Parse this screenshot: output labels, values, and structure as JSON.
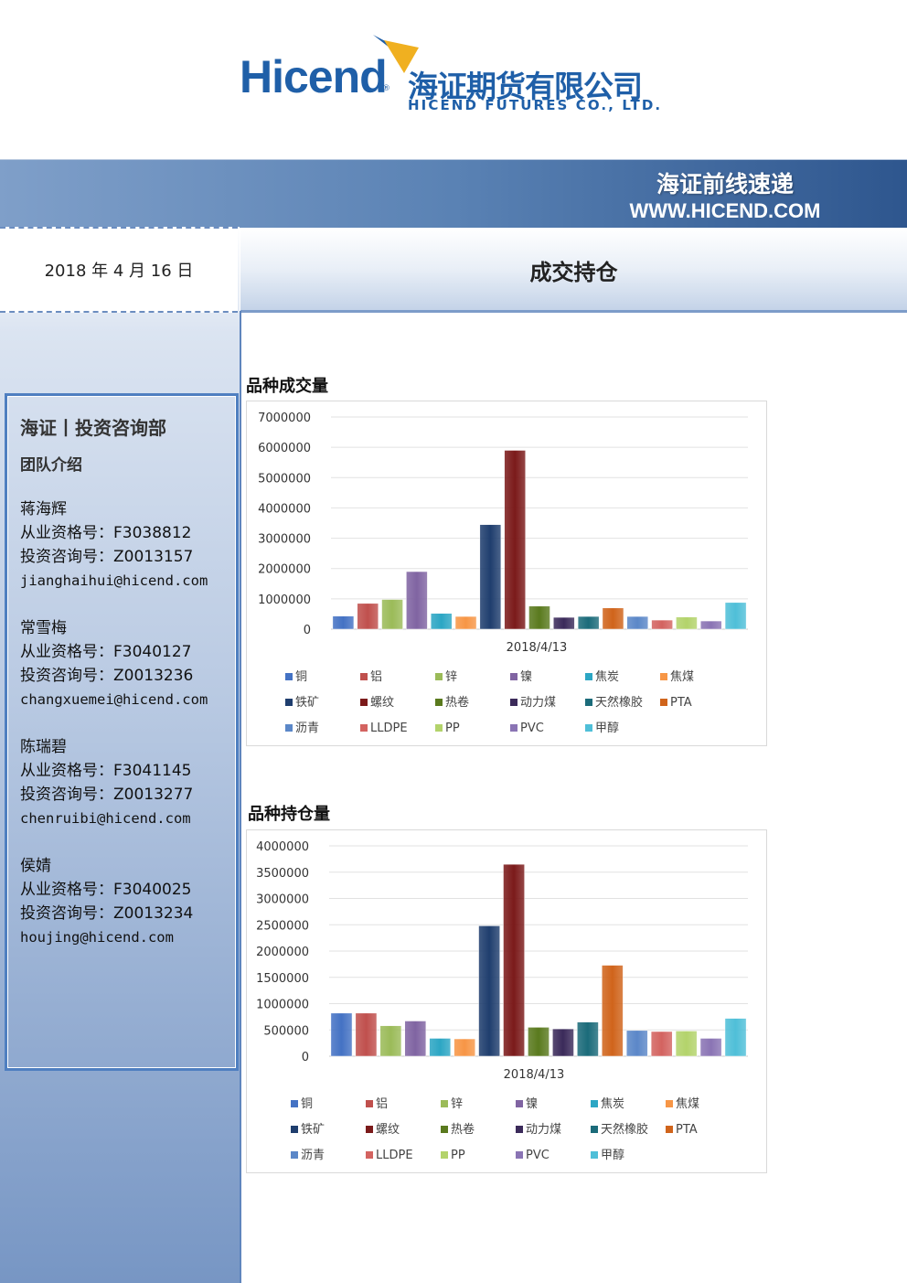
{
  "header": {
    "brand_en": "Hicend",
    "brand_reg": "®",
    "brand_cn": "海证期货有限公司",
    "brand_sub": "HICEND FUTURES CO., LTD.",
    "banner_cn": "海证前线速递",
    "banner_url": "WWW.HICEND.COM"
  },
  "date": "2018 年 4 月 16 日",
  "page_title": "成交持仓",
  "team": {
    "title": "海证丨投资咨询部",
    "subtitle": "团队介绍",
    "members": [
      {
        "name": "蒋海辉",
        "license": "从业资格号：F3038812",
        "advisor": "投资咨询号：Z0013157",
        "email": "jianghaihui@hicend.com"
      },
      {
        "name": "常雪梅",
        "license": "从业资格号：F3040127",
        "advisor": "投资咨询号：Z0013236",
        "email": "changxuemei@hicend.com"
      },
      {
        "name": "陈瑞碧",
        "license": "从业资格号：F3041145",
        "advisor": "投资咨询号：Z0013277",
        "email": "chenruibi@hicend.com"
      },
      {
        "name": "侯婧",
        "license": "从业资格号：F3040025",
        "advisor": "投资咨询号：Z0013234",
        "email": "houjing@hicend.com"
      }
    ]
  },
  "colors": {
    "brand_blue": "#1f5fa8",
    "banner_dark": "#2e568e",
    "frame_border": "#4f7fc0"
  },
  "chart_data": [
    {
      "type": "bar",
      "title": "品种成交量",
      "categories": [
        "2018/4/13"
      ],
      "ylim": [
        0,
        7000000
      ],
      "yticks": [
        0,
        1000000,
        2000000,
        3000000,
        4000000,
        5000000,
        6000000,
        7000000
      ],
      "grid": true,
      "legend_position": "bottom",
      "series": [
        {
          "name": "铜",
          "color": "#4472c4",
          "values": [
            430000
          ]
        },
        {
          "name": "铝",
          "color": "#c0504d",
          "values": [
            850000
          ]
        },
        {
          "name": "锌",
          "color": "#9bbb59",
          "values": [
            980000
          ]
        },
        {
          "name": "镍",
          "color": "#8064a2",
          "values": [
            1900000
          ]
        },
        {
          "name": "焦炭",
          "color": "#2ca6c4",
          "values": [
            520000
          ]
        },
        {
          "name": "焦煤",
          "color": "#f79646",
          "values": [
            420000
          ]
        },
        {
          "name": "铁矿",
          "color": "#1f3e6e",
          "values": [
            3450000
          ]
        },
        {
          "name": "螺纹",
          "color": "#7b1a1a",
          "values": [
            5900000
          ]
        },
        {
          "name": "热卷",
          "color": "#5a7a1e",
          "values": [
            760000
          ]
        },
        {
          "name": "动力煤",
          "color": "#3b2a5a",
          "values": [
            390000
          ]
        },
        {
          "name": "天然橡胶",
          "color": "#1b6b7a",
          "values": [
            420000
          ]
        },
        {
          "name": "PTA",
          "color": "#d0641b",
          "values": [
            700000
          ]
        },
        {
          "name": "沥青",
          "color": "#5b87c8",
          "values": [
            420000
          ]
        },
        {
          "name": "LLDPE",
          "color": "#d36360",
          "values": [
            300000
          ]
        },
        {
          "name": "PP",
          "color": "#b3d36b",
          "values": [
            400000
          ]
        },
        {
          "name": "PVC",
          "color": "#8a74b4",
          "values": [
            270000
          ]
        },
        {
          "name": "甲醇",
          "color": "#4fbfd8",
          "values": [
            880000
          ]
        }
      ]
    },
    {
      "type": "bar",
      "title": "品种持仓量",
      "categories": [
        "2018/4/13"
      ],
      "ylim": [
        0,
        4000000
      ],
      "yticks": [
        0,
        500000,
        1000000,
        1500000,
        2000000,
        2500000,
        3000000,
        3500000,
        4000000
      ],
      "grid": true,
      "legend_position": "bottom",
      "series": [
        {
          "name": "铜",
          "color": "#4472c4",
          "values": [
            820000
          ]
        },
        {
          "name": "铝",
          "color": "#c0504d",
          "values": [
            820000
          ]
        },
        {
          "name": "锌",
          "color": "#9bbb59",
          "values": [
            580000
          ]
        },
        {
          "name": "镍",
          "color": "#8064a2",
          "values": [
            670000
          ]
        },
        {
          "name": "焦炭",
          "color": "#2ca6c4",
          "values": [
            340000
          ]
        },
        {
          "name": "焦煤",
          "color": "#f79646",
          "values": [
            330000
          ]
        },
        {
          "name": "铁矿",
          "color": "#1f3e6e",
          "values": [
            2480000
          ]
        },
        {
          "name": "螺纹",
          "color": "#7b1a1a",
          "values": [
            3650000
          ]
        },
        {
          "name": "热卷",
          "color": "#5a7a1e",
          "values": [
            550000
          ]
        },
        {
          "name": "动力煤",
          "color": "#3b2a5a",
          "values": [
            520000
          ]
        },
        {
          "name": "天然橡胶",
          "color": "#1b6b7a",
          "values": [
            650000
          ]
        },
        {
          "name": "PTA",
          "color": "#d0641b",
          "values": [
            1730000
          ]
        },
        {
          "name": "沥青",
          "color": "#5b87c8",
          "values": [
            490000
          ]
        },
        {
          "name": "LLDPE",
          "color": "#d36360",
          "values": [
            470000
          ]
        },
        {
          "name": "PP",
          "color": "#b3d36b",
          "values": [
            480000
          ]
        },
        {
          "name": "PVC",
          "color": "#8a74b4",
          "values": [
            340000
          ]
        },
        {
          "name": "甲醇",
          "color": "#4fbfd8",
          "values": [
            720000
          ]
        }
      ]
    }
  ]
}
